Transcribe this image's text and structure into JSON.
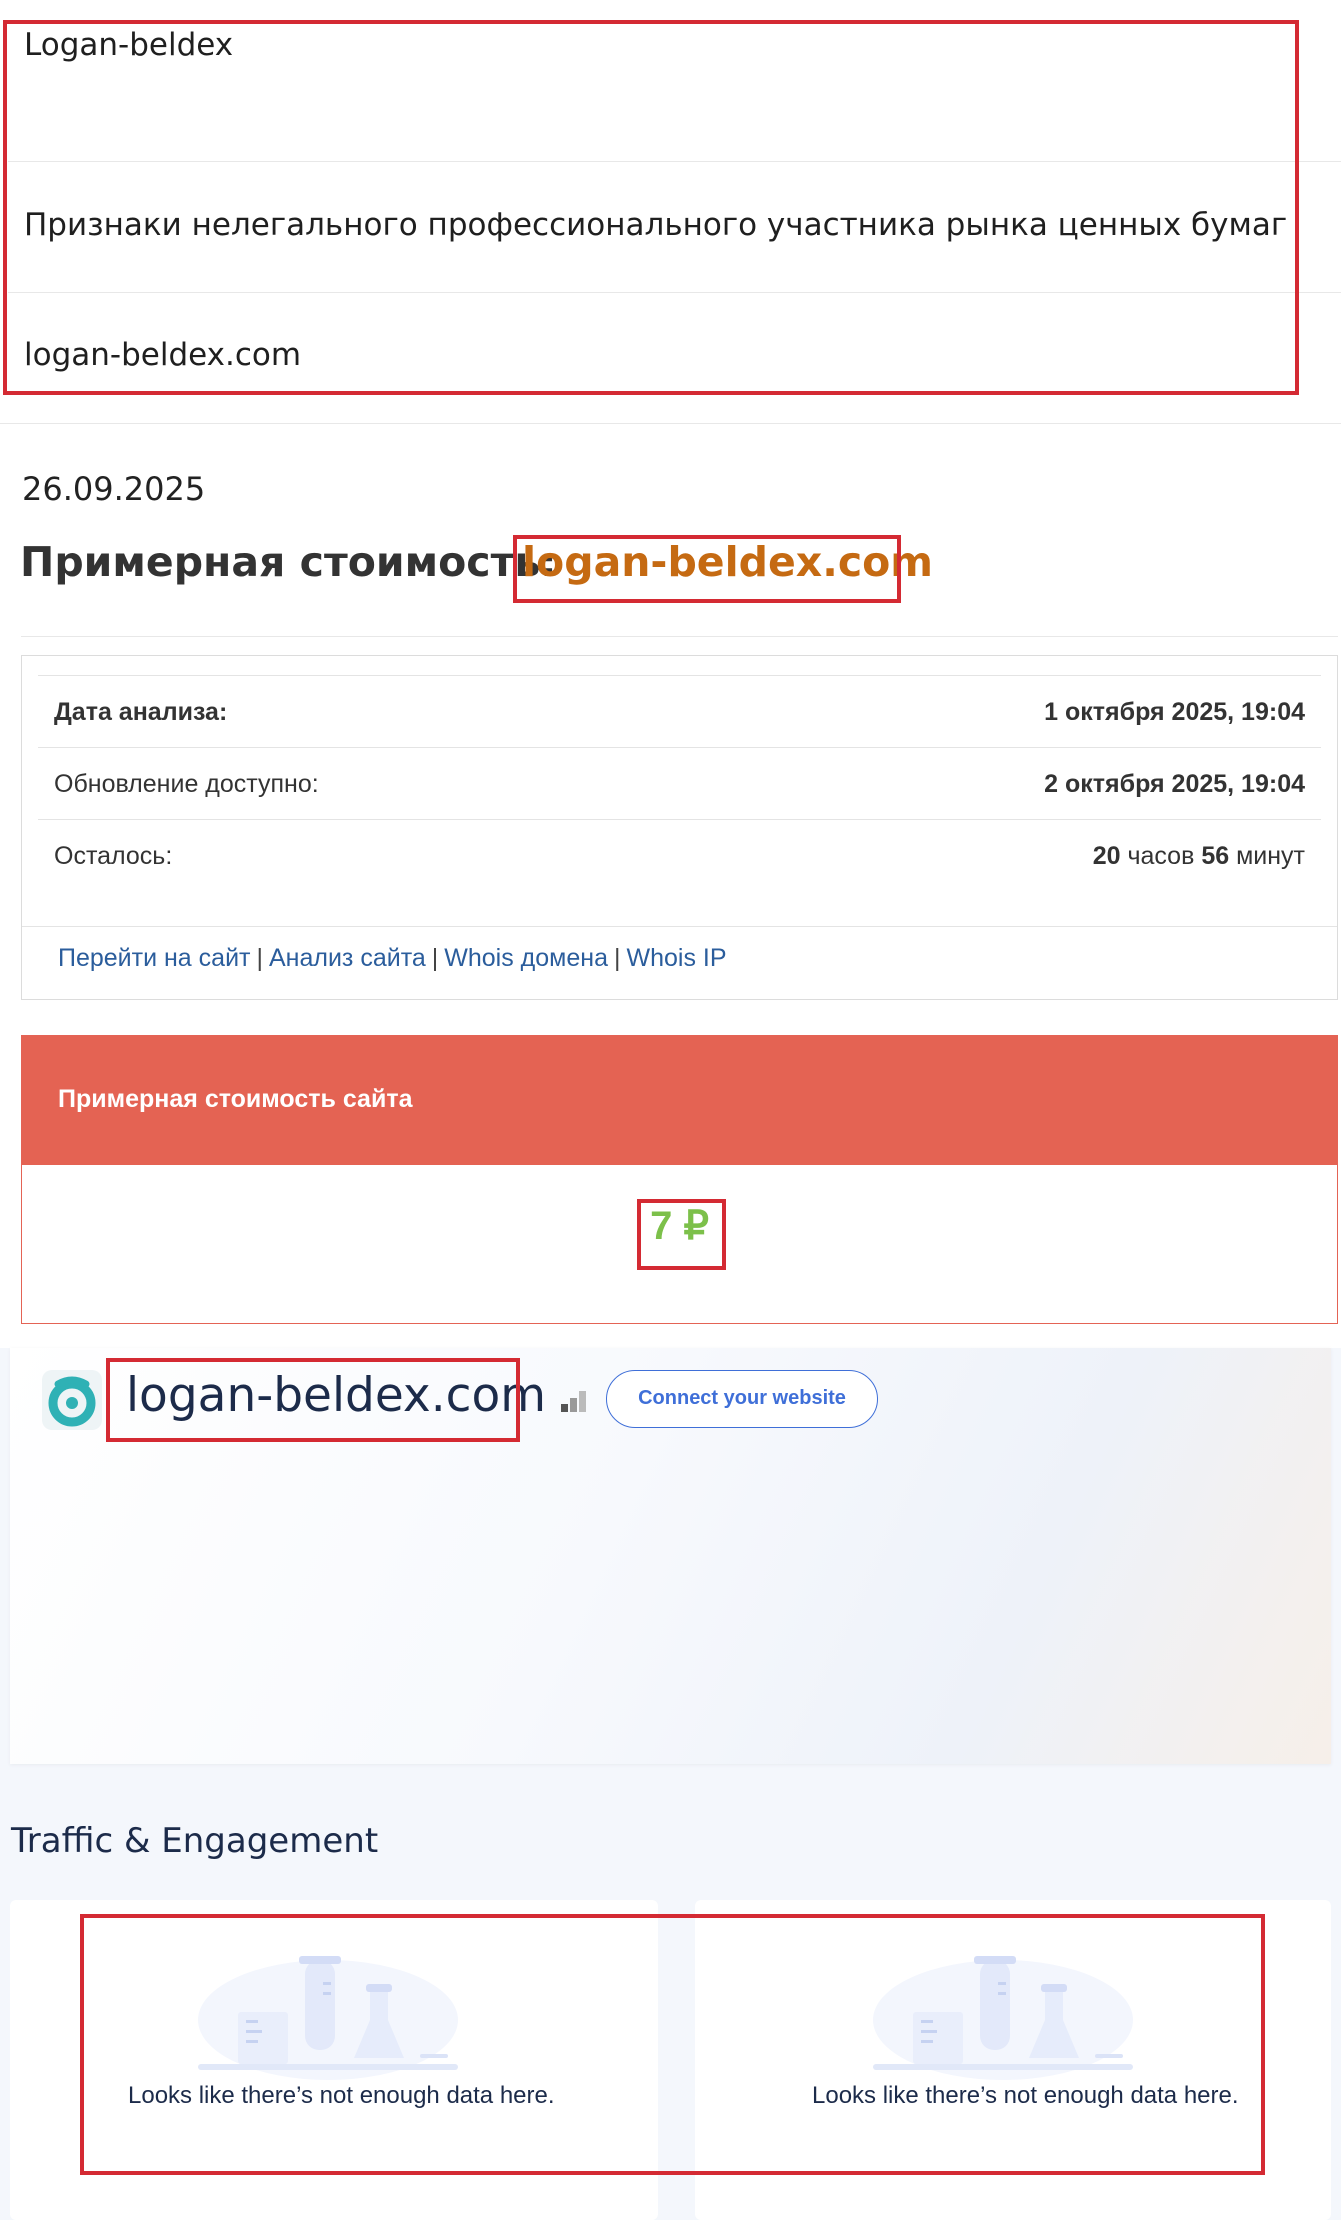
{
  "info": {
    "name": "Logan-beldex",
    "category": "Признаки нелегального профессионального участника рынка ценных бумаг",
    "site": "logan-beldex.com"
  },
  "estimate": {
    "date": "26.09.2025",
    "title": "Примерная стоимость:",
    "domain": "logan-beldex.com",
    "rows": [
      {
        "label": "Дата анализа:",
        "value": "1 октября 2025, 19:04"
      },
      {
        "label": "Обновление доступно:",
        "value": "2 октября 2025, 19:04"
      },
      {
        "label": "Осталось:",
        "hours": "20",
        "hours_unit": "часов",
        "minutes": "56",
        "minutes_unit": "минут"
      }
    ],
    "links": [
      "Перейти на сайт",
      "Анализ сайта",
      "Whois домена",
      "Whois IP"
    ],
    "separator": "|",
    "value_header": "Примерная стоимость сайта",
    "price": "7 ₽"
  },
  "traffic": {
    "domain": "logan-beldex.com",
    "connect_label": "Connect your website",
    "section_title": "Traffic & Engagement",
    "empty_message_left": "Looks like there’s not enough data here.",
    "empty_message_right": "Looks like there’s not enough data here."
  },
  "colors": {
    "highlight_box": "#d42a33",
    "domain_orange": "#c56a12",
    "header_red": "#e46353",
    "price_green": "#7cc04a",
    "link_blue": "#2b5d9c",
    "accent_blue": "#3f6fd8"
  }
}
